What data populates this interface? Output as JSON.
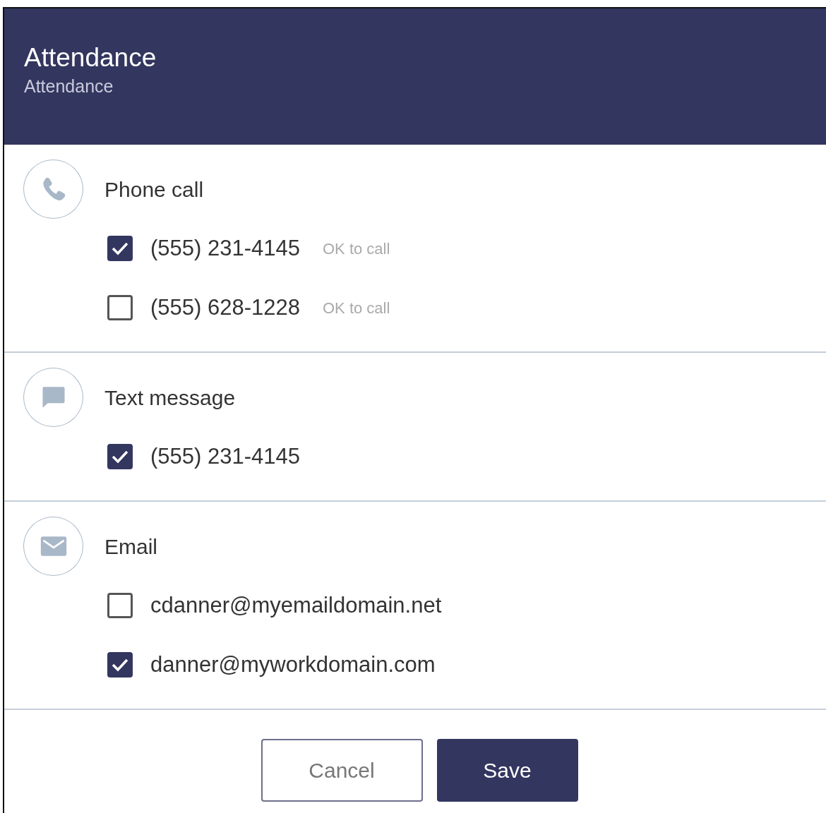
{
  "header": {
    "title": "Attendance",
    "subtitle": "Attendance"
  },
  "sections": [
    {
      "title": "Phone call",
      "items": [
        {
          "label": "(555) 231-4145",
          "note": "OK to call",
          "checked": true
        },
        {
          "label": "(555) 628-1228",
          "note": "OK to call",
          "checked": false
        }
      ]
    },
    {
      "title": "Text message",
      "items": [
        {
          "label": "(555) 231-4145",
          "checked": true
        }
      ]
    },
    {
      "title": "Email",
      "items": [
        {
          "label": "cdanner@myemaildomain.net",
          "checked": false
        },
        {
          "label": "danner@myworkdomain.com",
          "checked": true
        }
      ]
    }
  ],
  "buttons": [
    {
      "label": "Cancel",
      "kind": "secondary"
    },
    {
      "label": "Save",
      "kind": "primary"
    }
  ]
}
